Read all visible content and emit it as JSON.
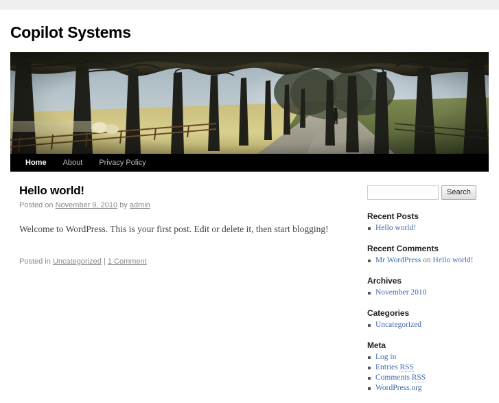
{
  "site": {
    "title": "Copilot Systems",
    "header_image_alt": "tree-lined avenue with walking person"
  },
  "nav": {
    "items": [
      {
        "label": "Home",
        "current": true
      },
      {
        "label": "About",
        "current": false
      },
      {
        "label": "Privacy Policy",
        "current": false
      }
    ]
  },
  "post": {
    "title": "Hello world!",
    "meta_posted_on": "Posted on",
    "meta_date": "November 9, 2010",
    "meta_by": "by",
    "meta_author": "admin",
    "content": "Welcome to WordPress. This is your first post. Edit or delete it, then start blogging!",
    "utility_posted_in": "Posted in",
    "utility_category": "Uncategorized",
    "utility_separator": "|",
    "utility_comments": "1 Comment"
  },
  "sidebar": {
    "search": {
      "value": "",
      "placeholder": "",
      "button_label": "Search"
    },
    "widgets": [
      {
        "title": "Recent Posts",
        "items": [
          {
            "link": "Hello world!"
          }
        ]
      },
      {
        "title": "Recent Comments",
        "items": [
          {
            "link": "Mr WordPress",
            "middle": " on ",
            "link2": "Hello world!"
          }
        ]
      },
      {
        "title": "Archives",
        "items": [
          {
            "link": "November 2010"
          }
        ]
      },
      {
        "title": "Categories",
        "items": [
          {
            "link": "Uncategorized"
          }
        ]
      },
      {
        "title": "Meta",
        "items": [
          {
            "link": "Log in"
          },
          {
            "link": "Entries RSS",
            "abbr": "RSS"
          },
          {
            "link": "Comments RSS",
            "abbr": "RSS"
          },
          {
            "link": "WordPress.org"
          }
        ]
      }
    ]
  },
  "colors": {
    "link": "#4169b0",
    "nav_bg": "#000000",
    "meta_text": "#888888",
    "top_strip": "#efefef"
  }
}
